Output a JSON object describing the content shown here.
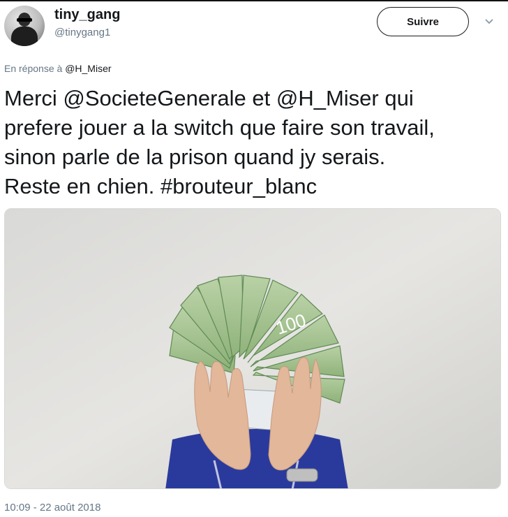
{
  "user": {
    "display_name": "tiny_gang",
    "handle": "@tinygang1"
  },
  "follow_button": {
    "label": "Suivre"
  },
  "reply": {
    "prefix": "En réponse à",
    "mention": "@H_Miser"
  },
  "tweet": {
    "lines": [
      "Merci @SocieteGenerale et @H_Miser qui",
      "prefere jouer a la switch que faire son travail,",
      "sinon parle de la prison quand jy serais.",
      "Reste en chien. #brouteur_blanc"
    ]
  },
  "media": {
    "banknote_label": "100"
  },
  "timestamp": "10:09 - 22 août 2018",
  "icons": {
    "avatar": "user-avatar",
    "dropdown": "chevron-down-icon"
  }
}
